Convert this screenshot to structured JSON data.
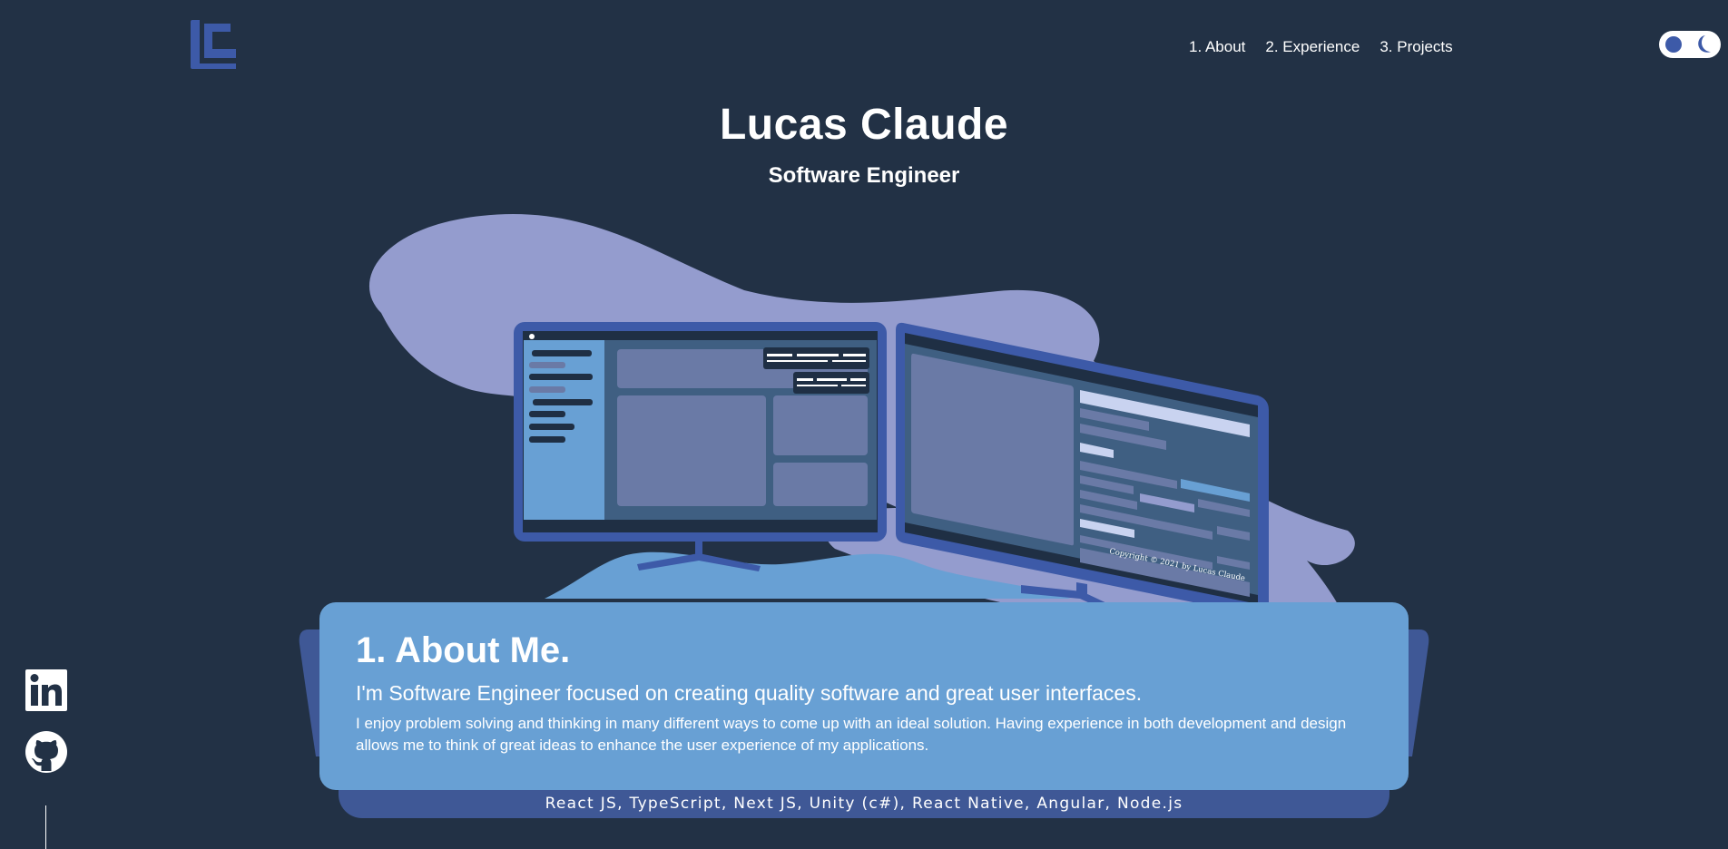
{
  "nav": {
    "items": [
      {
        "label": "1. About"
      },
      {
        "label": "2. Experience"
      },
      {
        "label": "3. Projects"
      }
    ]
  },
  "hero": {
    "name": "Lucas Claude",
    "role": "Software Engineer"
  },
  "illustration": {
    "copyright": "Copyright © 2021 by Lucas Claude"
  },
  "about": {
    "heading": "1. About Me.",
    "lead": "I'm Software Engineer focused on creating quality software and great user interfaces.",
    "body": "I enjoy problem solving and thinking in many different ways to come up with an ideal solution. Having experience in both development and design allows me to think of great ideas to enhance the user experience of my applications.",
    "skills": "React JS, TypeScript, Next JS, Unity (c#), React Native, Angular, Node.js"
  },
  "social": {
    "icons": [
      "linkedin-icon",
      "github-icon"
    ]
  },
  "colors": {
    "background": "#223145",
    "accent": "#3d5aa8",
    "card": "#68a0d4",
    "blob": "#949cce"
  }
}
